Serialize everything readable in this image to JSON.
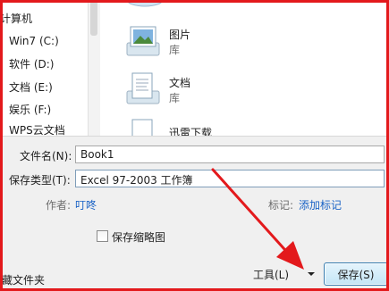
{
  "nav": {
    "collapsed_title": "计算机",
    "items": [
      {
        "label": "Win7 (C:)",
        "icon": "drive-os-icon"
      },
      {
        "label": "软件 (D:)",
        "icon": "drive-icon"
      },
      {
        "label": "文档 (E:)",
        "icon": "drive-icon"
      },
      {
        "label": "娱乐 (F:)",
        "icon": "drive-icon"
      },
      {
        "label": "WPS云文档",
        "icon": "cloud-drive-icon"
      }
    ]
  },
  "libraries": [
    {
      "name": "图片",
      "sub": "库",
      "icon": "pictures-library-icon"
    },
    {
      "name": "文档",
      "sub": "库",
      "icon": "documents-library-icon"
    },
    {
      "name": "迅雷下载",
      "sub": "",
      "icon": "downloads-library-icon"
    }
  ],
  "form": {
    "filename_label": "文件名(N):",
    "filename_value": "Book1",
    "filetype_label": "保存类型(T):",
    "filetype_value": "Excel 97-2003 工作簿",
    "author_label": "作者:",
    "author_value": "叮咚",
    "tags_label": "标记:",
    "tags_value": "添加标记",
    "thumbnail_label": "保存缩略图",
    "hide_folders_label": "藏文件夹",
    "tools_label": "工具(L)",
    "save_label": "保存(S)"
  },
  "colors": {
    "annotation_arrow": "#e3191c",
    "link": "#1a63c6"
  }
}
